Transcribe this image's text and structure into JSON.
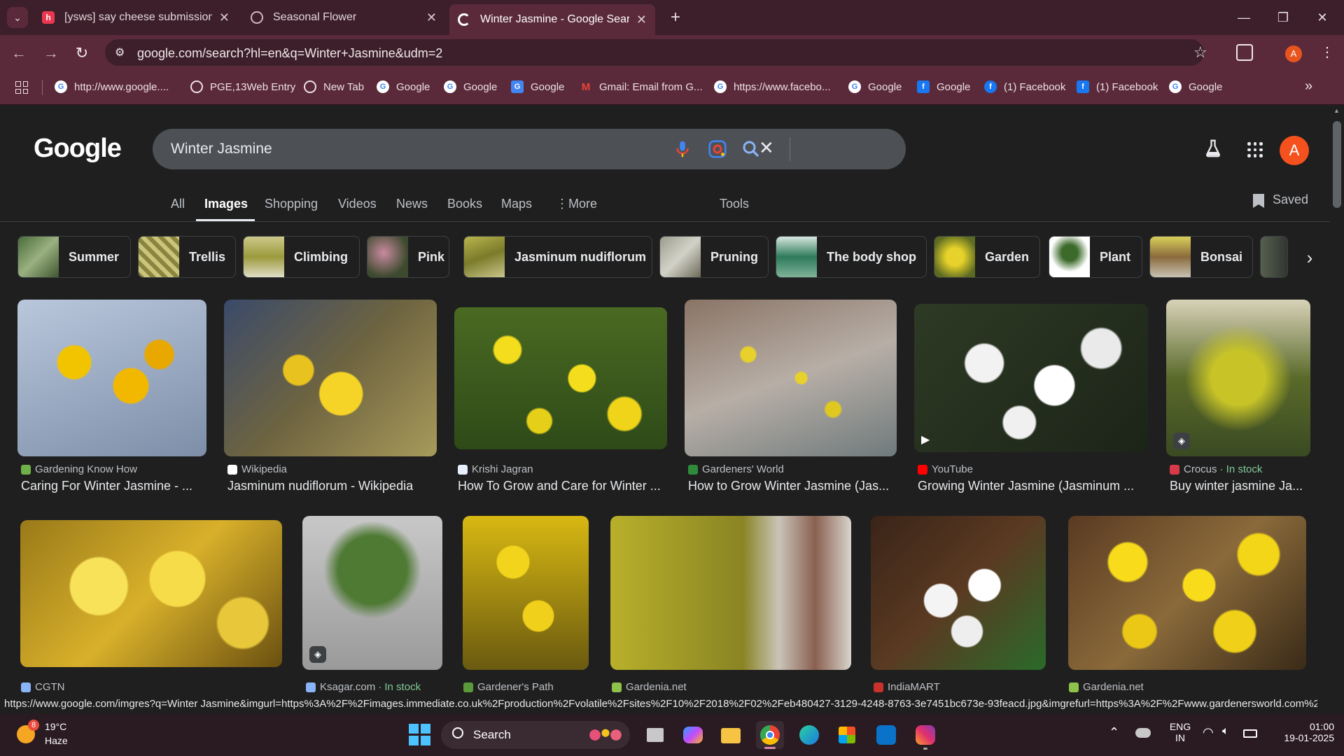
{
  "browser": {
    "tabs": [
      {
        "title": "[ysws] say cheese submission!",
        "icon": "hackclub-icon"
      },
      {
        "title": "Seasonal Flower",
        "icon": "globe-icon"
      },
      {
        "title": "Winter Jasmine - Google Search",
        "icon": "google-icon",
        "active": true
      }
    ],
    "url": "google.com/search?hl=en&q=Winter+Jasmine&udm=2",
    "profile_initial": "A",
    "bookmarks": [
      {
        "label": "http://www.google...."
      },
      {
        "label": "PGE,13Web Entry"
      },
      {
        "label": "New Tab"
      },
      {
        "label": "Google"
      },
      {
        "label": "Google"
      },
      {
        "label": "Google"
      },
      {
        "label": "Gmail: Email from G..."
      },
      {
        "label": "https://www.facebo..."
      },
      {
        "label": "Google"
      },
      {
        "label": "Google"
      },
      {
        "label": "(1) Facebook"
      },
      {
        "label": "(1) Facebook"
      },
      {
        "label": "Google"
      }
    ]
  },
  "google": {
    "logo": "Google",
    "query": "Winter Jasmine",
    "profile_initial": "A",
    "nav": [
      "All",
      "Images",
      "Shopping",
      "Videos",
      "News",
      "Books",
      "Maps",
      "More",
      "Tools"
    ],
    "saved_label": "Saved",
    "chips": [
      "Summer",
      "Trellis",
      "Climbing",
      "Pink",
      "Jasminum nudiflorum",
      "Pruning",
      "The body shop",
      "Garden",
      "Plant",
      "Bonsai"
    ],
    "row1": [
      {
        "source": "Gardening Know How",
        "caption": "Caring For Winter Jasmine - ...",
        "stock": ""
      },
      {
        "source": "Wikipedia",
        "caption": "Jasminum nudiflorum - Wikipedia",
        "stock": ""
      },
      {
        "source": "Krishi Jagran",
        "caption": "How To Grow and Care for Winter ...",
        "stock": ""
      },
      {
        "source": "Gardeners' World",
        "caption": "How to Grow Winter Jasmine (Jas...",
        "stock": ""
      },
      {
        "source": "YouTube",
        "caption": "Growing Winter Jasmine (Jasminum ...",
        "stock": ""
      },
      {
        "source": "Crocus",
        "caption": "Buy winter jasmine Ja...",
        "stock": "· In stock"
      }
    ],
    "row2": [
      {
        "source": "CGTN",
        "stock": ""
      },
      {
        "source": "Ksagar.com",
        "stock": "· In stock"
      },
      {
        "source": "Gardener's Path",
        "stock": ""
      },
      {
        "source": "Gardenia.net",
        "stock": ""
      },
      {
        "source": "IndiaMART",
        "stock": ""
      },
      {
        "source": "Gardenia.net",
        "stock": ""
      }
    ]
  },
  "status_url": "https://www.google.com/imgres?q=Winter Jasmine&imgurl=https%3A%2F%2Fimages.immediate.co.uk%2Fproduction%2Fvolatile%2Fsites%2F10%2F2018%2F02%2Feb480427-3129-4248-8763-3e7451bc673e-93feacd.jpg&imgrefurl=https%3A%2F%2Fwww.gardenersworld.com%2F...",
  "taskbar": {
    "weather_temp": "19°C",
    "weather_desc": "Haze",
    "weather_badge": "8",
    "search_label": "Search",
    "lang": "ENG",
    "region": "IN",
    "time": "01:00",
    "date": "19-01-2025"
  }
}
